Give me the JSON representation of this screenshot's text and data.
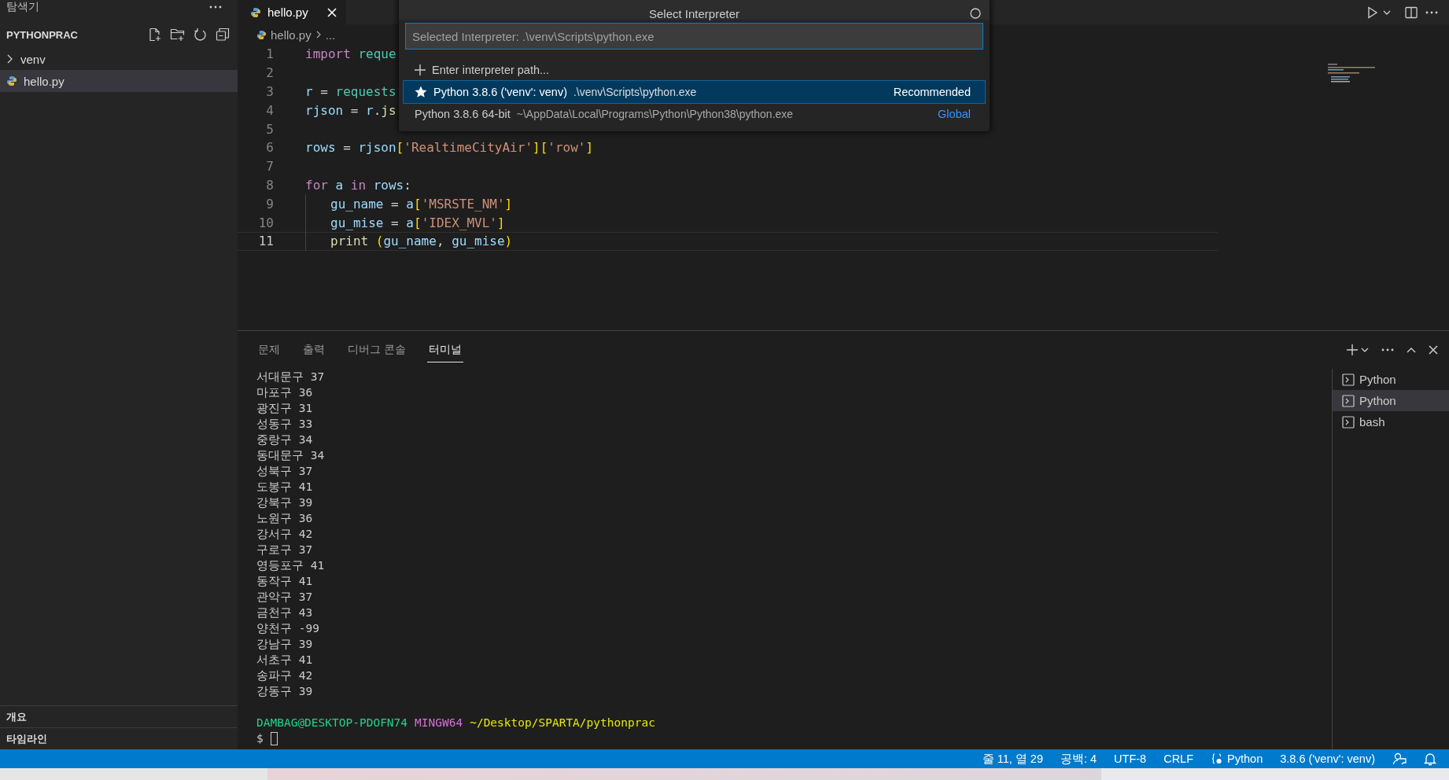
{
  "sidebar": {
    "title": "탐색기",
    "section": {
      "title": "PYTHONPRAC",
      "expanded": true
    },
    "tree": [
      {
        "label": "venv",
        "kind": "folder",
        "expanded": false,
        "selected": false
      },
      {
        "label": "hello.py",
        "kind": "python",
        "selected": true
      }
    ],
    "bottom_sections": [
      {
        "title": "개요"
      },
      {
        "title": "타임라인"
      }
    ]
  },
  "editor": {
    "tabs": [
      {
        "label": "hello.py",
        "selected": true
      }
    ],
    "breadcrumb": [
      "hello.py",
      "..."
    ],
    "lines": [
      {
        "number": "1",
        "current": false,
        "tokens": [
          {
            "kind": "kw",
            "text": "import "
          },
          {
            "kind": "mod",
            "text": "reque"
          }
        ]
      },
      {
        "number": "2",
        "current": false
      },
      {
        "number": "3",
        "current": false,
        "tokens": [
          {
            "kind": "var",
            "text": "r"
          },
          {
            "kind": "op",
            "text": " = "
          },
          {
            "kind": "mod",
            "text": "requests"
          }
        ]
      },
      {
        "number": "4",
        "current": false,
        "tokens": [
          {
            "kind": "var",
            "text": "rjson"
          },
          {
            "kind": "op",
            "text": " = "
          },
          {
            "kind": "var",
            "text": "r"
          },
          {
            "kind": "op",
            "text": "."
          },
          {
            "kind": "fn",
            "text": "js"
          }
        ]
      },
      {
        "number": "5",
        "current": false
      },
      {
        "number": "6",
        "current": false,
        "tokens": [
          {
            "kind": "var",
            "text": "rows"
          },
          {
            "kind": "op",
            "text": " = "
          },
          {
            "kind": "var",
            "text": "rjson"
          },
          {
            "kind": "brk",
            "text": "["
          },
          {
            "kind": "str",
            "text": "'RealtimeCityAir'"
          },
          {
            "kind": "brk",
            "text": "]["
          },
          {
            "kind": "str",
            "text": "'row'"
          },
          {
            "kind": "brk",
            "text": "]"
          }
        ]
      },
      {
        "number": "7",
        "current": false
      },
      {
        "number": "8",
        "current": false,
        "tokens": [
          {
            "kind": "kw",
            "text": "for "
          },
          {
            "kind": "var",
            "text": "a "
          },
          {
            "kind": "kw",
            "text": "in "
          },
          {
            "kind": "var",
            "text": "rows"
          },
          {
            "kind": "op",
            "text": ":"
          }
        ]
      },
      {
        "number": "9",
        "current": false,
        "indented": true,
        "tokens": [
          {
            "kind": "var",
            "text": "gu_name"
          },
          {
            "kind": "op",
            "text": " = "
          },
          {
            "kind": "var",
            "text": "a"
          },
          {
            "kind": "brk",
            "text": "["
          },
          {
            "kind": "str",
            "text": "'MSRSTE_NM'"
          },
          {
            "kind": "brk",
            "text": "]"
          }
        ]
      },
      {
        "number": "10",
        "current": false,
        "indented": true,
        "tokens": [
          {
            "kind": "var",
            "text": "gu_mise"
          },
          {
            "kind": "op",
            "text": " = "
          },
          {
            "kind": "var",
            "text": "a"
          },
          {
            "kind": "brk",
            "text": "["
          },
          {
            "kind": "str",
            "text": "'IDEX_MVL'"
          },
          {
            "kind": "brk",
            "text": "]"
          }
        ]
      },
      {
        "number": "11",
        "current": true,
        "indented": true,
        "tokens": [
          {
            "kind": "fn",
            "text": "print "
          },
          {
            "kind": "brk",
            "text": "("
          },
          {
            "kind": "var",
            "text": "gu_name"
          },
          {
            "kind": "op",
            "text": ", "
          },
          {
            "kind": "var",
            "text": "gu_mise"
          },
          {
            "kind": "brk",
            "text": ")"
          }
        ]
      }
    ]
  },
  "quick_pick": {
    "title": "Select Interpreter",
    "input": {
      "placeholder": "Selected Interpreter: .\\venv\\Scripts\\python.exe"
    },
    "items": [
      {
        "kind": "action",
        "label": "Enter interpreter path...",
        "selected": false
      },
      {
        "kind": "interpreter",
        "starred": true,
        "label": "Python 3.8.6 ('venv': venv)",
        "description": ".\\venv\\Scripts\\python.exe",
        "badge": "Recommended",
        "selected": true
      },
      {
        "kind": "interpreter",
        "starred": false,
        "label": "Python 3.8.6 64-bit",
        "description": "~\\AppData\\Local\\Programs\\Python\\Python38\\python.exe",
        "badge": "Global",
        "selected": false
      }
    ]
  },
  "panel": {
    "tabs": [
      {
        "label": "문제",
        "selected": false
      },
      {
        "label": "출력",
        "selected": false
      },
      {
        "label": "디버그 콘솔",
        "selected": false
      },
      {
        "label": "터미널",
        "selected": true
      }
    ],
    "terminal_lines": [
      "서대문구 37",
      "마포구 36",
      "광진구 31",
      "성동구 33",
      "중랑구 34",
      "동대문구 34",
      "성북구 37",
      "도봉구 41",
      "강북구 39",
      "노원구 36",
      "강서구 42",
      "구로구 37",
      "영등포구 41",
      "동작구 41",
      "관악구 37",
      "금천구 43",
      "양천구 -99",
      "강남구 39",
      "서초구 41",
      "송파구 42",
      "강동구 39"
    ],
    "prompt": {
      "user": "DAMBAG@DESKTOP-PDOFN74",
      "system": "MINGW64",
      "path": "~/Desktop/SPARTA/pythonprac",
      "symbol": "$"
    },
    "terminals": [
      {
        "label": "Python",
        "selected": false
      },
      {
        "label": "Python",
        "selected": true
      },
      {
        "label": "bash",
        "selected": false
      }
    ]
  },
  "status_bar": {
    "items": [
      {
        "kind": "text",
        "label": "줄 11, 열 29"
      },
      {
        "kind": "text",
        "label": "공백: 4"
      },
      {
        "kind": "text",
        "label": "UTF-8"
      },
      {
        "kind": "text",
        "label": "CRLF"
      },
      {
        "kind": "language",
        "label": "Python"
      },
      {
        "kind": "text",
        "label": "3.8.6 ('venv': venv)"
      }
    ]
  }
}
